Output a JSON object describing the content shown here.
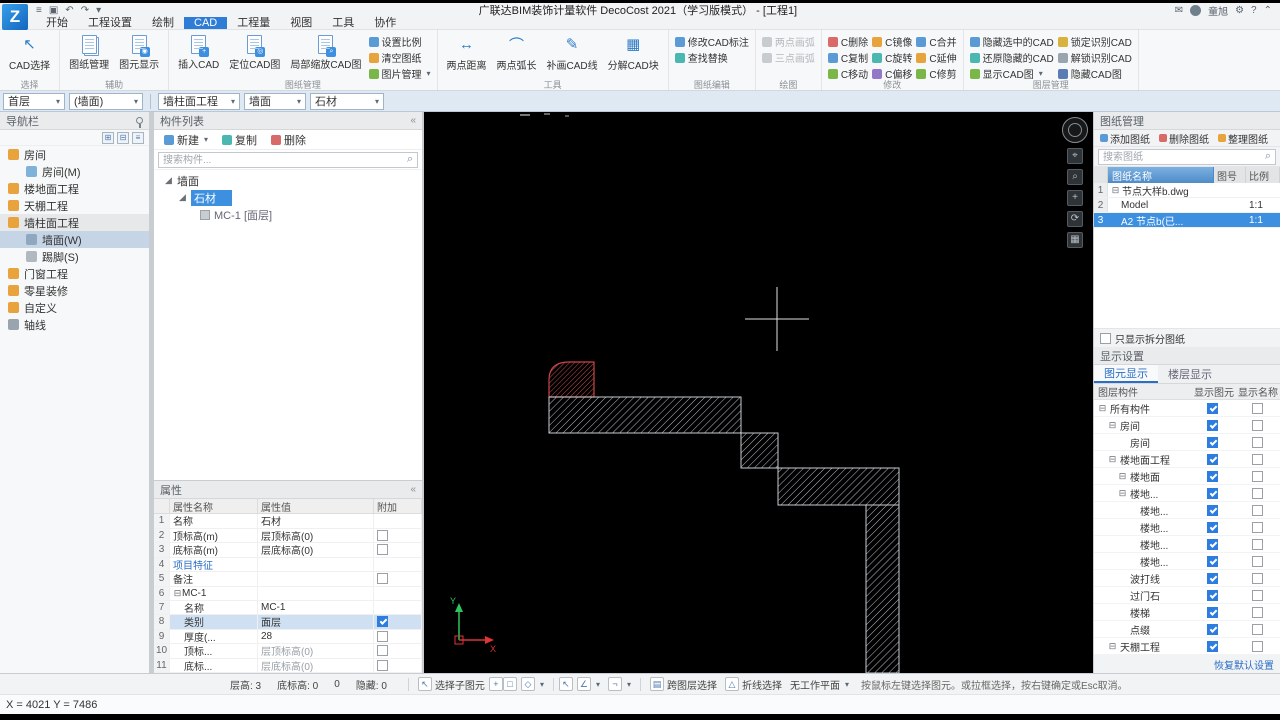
{
  "icons": {
    "menu": "≡",
    "save": "▣",
    "undo": "↶",
    "redo": "↷",
    "caret_down": "▾",
    "mail": "✉",
    "gear": "⚙",
    "help": "?",
    "chevron_up": "⌃",
    "search": "⌕",
    "collapse": "«",
    "tree_open": "◢",
    "group_minus": "⊟",
    "cursor": "↖",
    "angle": "∠",
    "square": "□",
    "diamond": "◇",
    "neg": "¬",
    "plus": "+",
    "cross_layer": "▤",
    "polyline": "△",
    "measure": "↔",
    "arc": "⌒",
    "pencil": "✎",
    "blocks": "▦",
    "find": "⌕",
    "target": "⌖",
    "orbit": "⟳",
    "delete_x": "✕"
  },
  "titlebar": {
    "logo": "Z",
    "title": "广联达BIM装饰计量软件 DecoCost 2021（学习版模式） - [工程1]",
    "user": "童旭"
  },
  "tabs": {
    "items": [
      "开始",
      "工程设置",
      "绘制",
      "CAD",
      "工程量",
      "视图",
      "工具",
      "协作"
    ]
  },
  "ribbon": {
    "select_group": {
      "label": "选择",
      "cad_select": "CAD选择"
    },
    "aux_group": {
      "label": "辅助",
      "sheet_mgmt": "图纸管理",
      "elem_display": "图元显示"
    },
    "sheet_group": {
      "label": "图纸管理",
      "insert": "插入CAD",
      "locate": "定位CAD图",
      "zoom_part": "局部缩放CAD图",
      "set_scale": "设置比例",
      "clear": "清空图纸",
      "image_mgmt": "图片管理"
    },
    "tool_group": {
      "label": "工具",
      "dist": "两点距离",
      "arc_len": "两点弧长",
      "redraw": "补画CAD线",
      "explode": "分解CAD块"
    },
    "edit_group": {
      "label": "图纸编辑",
      "modify_dim": "修改CAD标注",
      "find_replace": "查找替换"
    },
    "draw_group": {
      "label": "绘图",
      "arc2": "两点画弧",
      "arc3": "三点画弧"
    },
    "modify_group": {
      "label": "修改",
      "col1": [
        "C删除",
        "C复制",
        "C移动"
      ],
      "col2": [
        "C镜像",
        "C旋转",
        "C偏移"
      ],
      "col3": [
        "C合并",
        "C延伸",
        "C修剪"
      ]
    },
    "layer_group": {
      "label": "图层管理",
      "col1": [
        "隐藏选中的CAD",
        "还原隐藏的CAD",
        "显示CAD图"
      ],
      "col2": [
        "锁定识别CAD",
        "解锁识别CAD",
        "隐藏CAD图"
      ]
    }
  },
  "context_bar": {
    "floor": "首层",
    "element": "(墙面)",
    "category": "墙柱面工程",
    "type": "墙面",
    "component": "石材"
  },
  "nav": {
    "title": "导航栏",
    "items": [
      {
        "label": "房间"
      },
      {
        "label": "房间(M)"
      },
      {
        "label": "楼地面工程"
      },
      {
        "label": "天棚工程"
      },
      {
        "label": "墙柱面工程"
      },
      {
        "label": "墙面(W)",
        "selected": true
      },
      {
        "label": "踢脚(S)"
      },
      {
        "label": "门窗工程"
      },
      {
        "label": "零星装修"
      },
      {
        "label": "自定义"
      },
      {
        "label": "轴线"
      }
    ]
  },
  "components": {
    "title": "构件列表",
    "toolbar": {
      "new": "新建",
      "copy": "复制",
      "del": "删除"
    },
    "search_placeholder": "搜索构件...",
    "tree": {
      "root": "墙面",
      "selected": "石材",
      "leaf": "MC-1 [面层]"
    }
  },
  "properties": {
    "title": "属性",
    "columns": [
      "属性名称",
      "属性值",
      "附加"
    ],
    "rows": [
      {
        "num": "1",
        "name": "名称",
        "value": "石材"
      },
      {
        "num": "2",
        "name": "顶标高(m)",
        "value": "层顶标高(0)",
        "checked": false
      },
      {
        "num": "3",
        "name": "底标高(m)",
        "value": "层底标高(0)",
        "checked": false
      },
      {
        "num": "4",
        "name": "项目特征",
        "value": ""
      },
      {
        "num": "5",
        "name": "备注",
        "value": "",
        "checked": false
      },
      {
        "num": "6",
        "name": "MC-1",
        "value": ""
      },
      {
        "num": "7",
        "name": "名称",
        "value": "MC-1"
      },
      {
        "num": "8",
        "name": "类别",
        "value": "面层",
        "checked": true,
        "selected": true
      },
      {
        "num": "9",
        "name": "厚度(...",
        "value": "28",
        "checked": false
      },
      {
        "num": "10",
        "name": "顶标...",
        "value": "层顶标高(0)",
        "checked": false
      },
      {
        "num": "11",
        "name": "底标...",
        "value": "层底标高(0)",
        "checked": false
      }
    ]
  },
  "sheets": {
    "title": "图纸管理",
    "actions": {
      "add": "添加图纸",
      "del": "删除图纸",
      "organize": "整理图纸"
    },
    "search_placeholder": "搜索图纸",
    "columns": [
      "图纸名称",
      "图号",
      "比例"
    ],
    "rows": [
      {
        "num": "1",
        "name": "节点大样b.dwg",
        "no": "",
        "scale": ""
      },
      {
        "num": "2",
        "name": "Model",
        "no": "",
        "scale": "1:1"
      },
      {
        "num": "3",
        "name": "A2 节点b(已...",
        "no": "",
        "scale": "1:1",
        "selected": true
      }
    ],
    "filter_label": "只显示拆分图纸"
  },
  "display": {
    "title": "显示设置",
    "tabs": [
      "图元显示",
      "楼层显示"
    ],
    "columns": [
      "图层构件",
      "显示图元",
      "显示名称"
    ],
    "rows": [
      {
        "name": "所有构件",
        "show": true,
        "show_name": false
      },
      {
        "name": "房间",
        "show": true,
        "show_name": false
      },
      {
        "name": "房间",
        "show": true,
        "show_name": false
      },
      {
        "name": "楼地面工程",
        "show": true,
        "show_name": false
      },
      {
        "name": "楼地面",
        "show": true,
        "show_name": false
      },
      {
        "name": "楼地...",
        "show": true,
        "show_name": false
      },
      {
        "name": "楼地...",
        "show": true,
        "show_name": false
      },
      {
        "name": "楼地...",
        "show": true,
        "show_name": false
      },
      {
        "name": "楼地...",
        "show": true,
        "show_name": false
      },
      {
        "name": "楼地...",
        "show": true,
        "show_name": false
      },
      {
        "name": "波打线",
        "show": true,
        "show_name": false
      },
      {
        "name": "过门石",
        "show": true,
        "show_name": false
      },
      {
        "name": "楼梯",
        "show": true,
        "show_name": false
      },
      {
        "name": "点缀",
        "show": true,
        "show_name": false
      },
      {
        "name": "天棚工程",
        "show": true,
        "show_name": false
      }
    ],
    "reset": "恢复默认设置"
  },
  "canvas": {
    "axis_x": "X",
    "axis_y": "Y"
  },
  "statusbar": {
    "floor_height": "层高: 3",
    "bottom_elev": "底标高: 0",
    "extra": "0",
    "hidden": "隐藏: 0",
    "select_sub": "选择子图元",
    "cross_layer": "跨图层选择",
    "polyline": "折线选择",
    "workplane": "无工作平面",
    "hint": "按鼠标左键选择图元。或拉框选择，按右键确定或Esc取消。"
  },
  "coordbar": {
    "text": "X = 4021 Y = 7486"
  }
}
